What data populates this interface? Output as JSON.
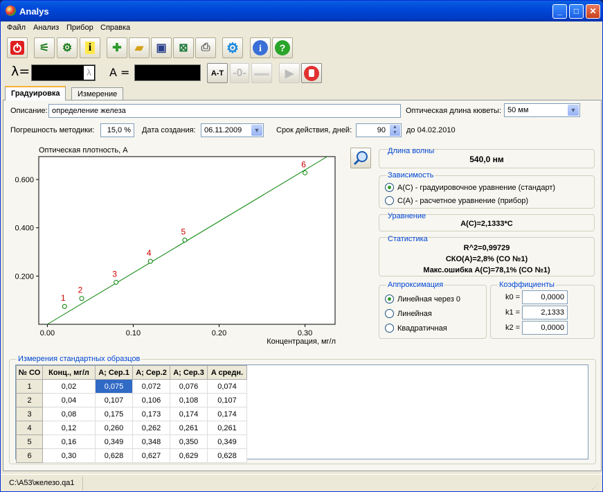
{
  "window": {
    "title": "Analys"
  },
  "menu": [
    "Файл",
    "Анализ",
    "Прибор",
    "Справка"
  ],
  "meter": {
    "lambda_label": "λ=",
    "lambda_icon": "λ",
    "a_label": "A =",
    "at_button": "A-T",
    "zero_button": "-0-"
  },
  "tabs": [
    "Градуировка",
    "Измерение"
  ],
  "form": {
    "description_label": "Описание:",
    "description_value": "определение железа",
    "path_label": "Оптическая длина кюветы:",
    "path_value": "50 мм",
    "error_label": "Погрешность методики:",
    "error_value": "15,0 %",
    "date_label": "Дата создания:",
    "date_value": "06.11.2009",
    "validity_label": "Срок действия, дней:",
    "validity_value": "90",
    "validity_until": "до 04.02.2010"
  },
  "chart_data": {
    "type": "scatter",
    "ylabel": "Оптическая плотность, A",
    "xlabel": "Концентрация, мг/л",
    "xlim": [
      -0.01,
      0.335
    ],
    "ylim": [
      0.0,
      0.695
    ],
    "xticks": [
      "0.00",
      "0.10",
      "0.20",
      "0.30"
    ],
    "xtick_values": [
      0,
      0.1,
      0.2,
      0.3
    ],
    "yticks": [
      "0.200",
      "0.400",
      "0.600"
    ],
    "ytick_values": [
      0.2,
      0.4,
      0.6
    ],
    "x": [
      0.02,
      0.04,
      0.08,
      0.12,
      0.16,
      0.3
    ],
    "y": [
      0.074,
      0.107,
      0.174,
      0.261,
      0.349,
      0.628
    ],
    "point_labels": [
      "1",
      "2",
      "3",
      "4",
      "5",
      "6"
    ],
    "fit": {
      "slope": 2.1333,
      "intercept": 0
    },
    "colors": {
      "points": "#008000",
      "fit": "#008000",
      "labels": "#cc0000"
    }
  },
  "right": {
    "wavelength_title": "Длина волны",
    "wavelength_value": "540,0 нм",
    "dependency_title": "Зависимость",
    "dep_option1": "A(C) - градуировочное уравнение (стандарт)",
    "dep_option2": "C(A) - расчетное уравнение (прибор)",
    "equation_title": "Уравнение",
    "equation_value": "A(C)=2,1333*C",
    "stats_title": "Статистика",
    "stat1": "R^2=0,99729",
    "stat2": "СКО(A)=2,8% (CO №1)",
    "stat3": "Макс.ошибка A(C)=78,1% (CO №1)",
    "approx_title": "Аппроксимация",
    "approx1": "Линейная через 0",
    "approx2": "Линейная",
    "approx3": "Квадратичная",
    "coef_title": "Коэффициенты",
    "k0_label": "k0 =",
    "k0": "0,0000",
    "k1_label": "k1 =",
    "k1": "2,1333",
    "k2_label": "k2 =",
    "k2": "0,0000"
  },
  "table": {
    "title": "Измерения стандартных образцов",
    "headers": [
      "№ СО",
      "Конц., мг/л",
      "A; Сер.1",
      "A; Сер.2",
      "A; Сер.3",
      "A средн."
    ],
    "rows": [
      [
        "1",
        "0,02",
        "0,075",
        "0,072",
        "0,076",
        "0,074"
      ],
      [
        "2",
        "0,04",
        "0,107",
        "0,106",
        "0,108",
        "0,107"
      ],
      [
        "3",
        "0,08",
        "0,175",
        "0,173",
        "0,174",
        "0,174"
      ],
      [
        "4",
        "0,12",
        "0,260",
        "0,262",
        "0,261",
        "0,261"
      ],
      [
        "5",
        "0,16",
        "0,349",
        "0,348",
        "0,350",
        "0,349"
      ],
      [
        "6",
        "0,30",
        "0,628",
        "0,627",
        "0,629",
        "0,628"
      ]
    ]
  },
  "status": {
    "path": "C:\\A53\\железо.qa1"
  }
}
